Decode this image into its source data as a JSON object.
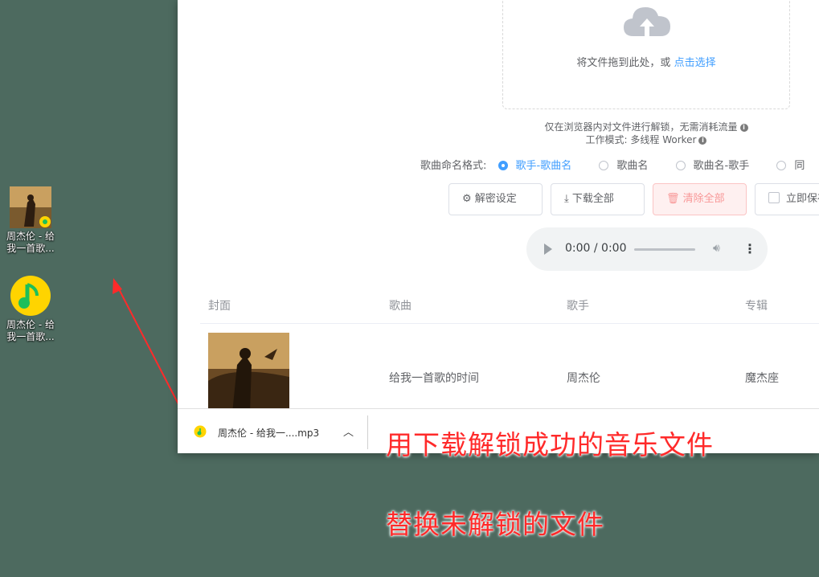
{
  "desktop": {
    "icons": [
      {
        "label_line1": "周杰伦 - 给",
        "label_line2": "我一首歌...",
        "type": "album-file"
      },
      {
        "label_line1": "周杰伦 - 给",
        "label_line2": "我一首歌...",
        "type": "qqmusic-file"
      }
    ]
  },
  "upload": {
    "drop_text": "将文件拖到此处，或",
    "drop_link": "点击选择",
    "note1": "仅在浏览器内对文件进行解锁，无需消耗流量",
    "note2": "工作模式: 多线程 Worker"
  },
  "naming": {
    "label": "歌曲命名格式:",
    "options": [
      "歌手-歌曲名",
      "歌曲名",
      "歌曲名-歌手",
      "同"
    ],
    "selected": "歌手-歌曲名"
  },
  "toolbar": {
    "decrypt_settings": "解密设定",
    "download_all": "下载全部",
    "clear_all": "清除全部",
    "save_now": "立即保存"
  },
  "player": {
    "time": "0:00 / 0:00"
  },
  "table": {
    "headers": [
      "封面",
      "歌曲",
      "歌手",
      "专辑"
    ],
    "rows": [
      {
        "song": "给我一首歌的时间",
        "artist": "周杰伦",
        "album": "魔杰座"
      }
    ]
  },
  "download_bar": {
    "filename": "周杰伦 - 给我一....mp3"
  },
  "annotations": {
    "line1": "用下载解锁成功的音乐文件",
    "line2": "替换未解锁的文件",
    "color": "#ff2a2a"
  },
  "colors": {
    "accent": "#409eff",
    "desktop": "#4d6a5f",
    "danger": "#f89898"
  }
}
